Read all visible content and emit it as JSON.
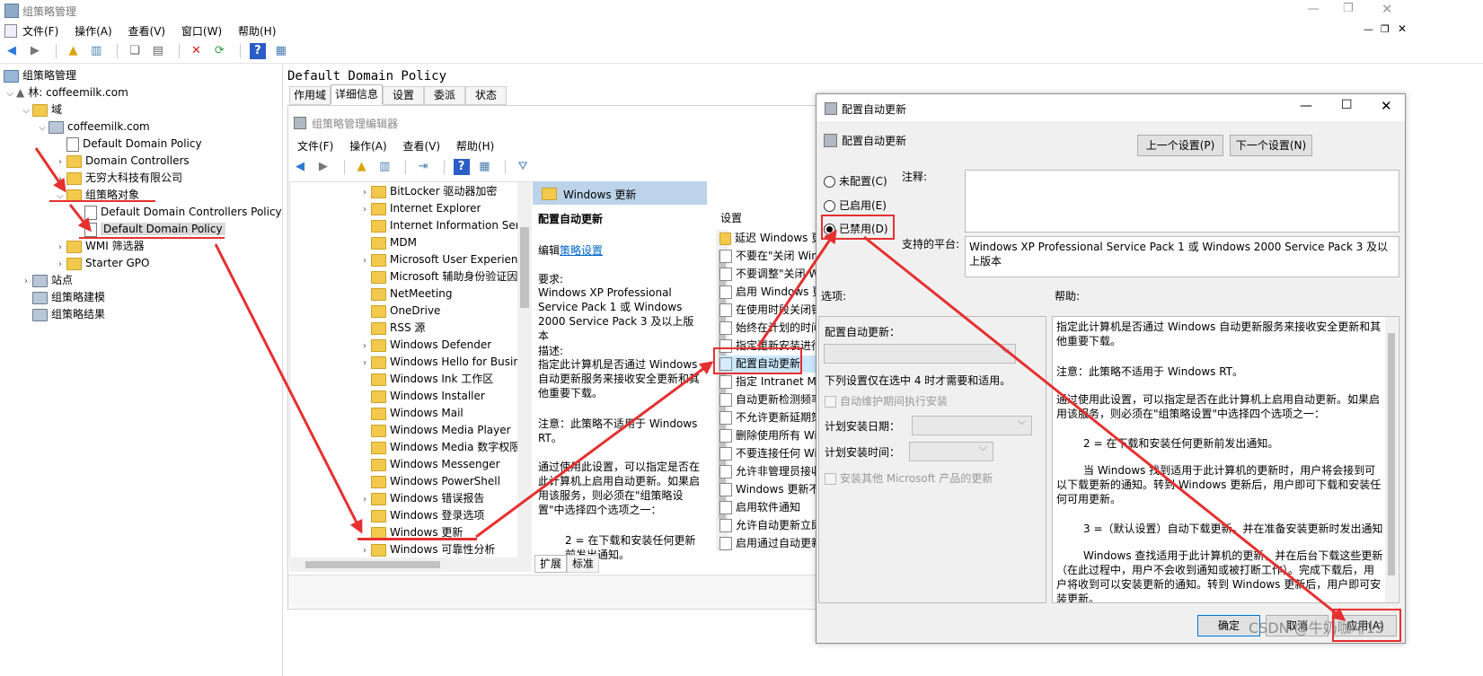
{
  "main_window": {
    "title": "组策略管理",
    "menu": [
      "文件(F)",
      "操作(A)",
      "查看(V)",
      "窗口(W)",
      "帮助(H)"
    ]
  },
  "tree": {
    "root": "组策略管理",
    "forest": "林: coffeemilk.com",
    "domains": "域",
    "domain": "coffeemilk.com",
    "items": [
      "Default Domain Policy",
      "Domain Controllers",
      "无穷大科技有限公司",
      "组策略对象",
      "Default Domain Controllers Policy",
      "Default Domain Policy",
      "WMI 筛选器",
      "Starter GPO"
    ],
    "sites": "站点",
    "modeling": "组策略建模",
    "results": "组策略结果"
  },
  "detail": {
    "title": "Default Domain Policy",
    "tabs": [
      "作用域",
      "详细信息",
      "设置",
      "委派",
      "状态"
    ]
  },
  "editor": {
    "title": "组策略管理编辑器",
    "menu": [
      "文件(F)",
      "操作(A)",
      "查看(V)",
      "帮助(H)"
    ],
    "tree_items": [
      "BitLocker 驱动器加密",
      "Internet Explorer",
      "Internet Information Serv",
      "MDM",
      "Microsoft User Experienc",
      "Microsoft 辅助身份验证因",
      "NetMeeting",
      "OneDrive",
      "RSS 源",
      "Windows Defender",
      "Windows Hello for Busin",
      "Windows Ink 工作区",
      "Windows Installer",
      "Windows Mail",
      "Windows Media Player",
      "Windows Media 数字权限",
      "Windows Messenger",
      "Windows PowerShell",
      "Windows 错误报告",
      "Windows 登录选项",
      "Windows 更新",
      "Windows 可靠性分析"
    ],
    "panel_header": "Windows 更新",
    "selected_title": "配置自动更新",
    "edit_prefix": "编辑",
    "edit_link": "策略设置",
    "requirements_label": "要求:",
    "requirements_text": "Windows XP Professional Service Pack 1 或 Windows 2000 Service Pack 3 及以上版本",
    "description_label": "描述:",
    "description_1": "指定此计算机是否通过 Windows 自动更新服务来接收安全更新和其他重要下载。",
    "description_2": "注意：此策略不适用于 Windows RT。",
    "description_3": "通过使用此设置，可以指定是否在此计算机上启用自动更新。如果启用该服务，则必须在\"组策略设置\"中选择四个选项之一：",
    "description_4": "2 = 在下载和安装任何更新前发出通知。",
    "settings_header": "设置",
    "settings_items": [
      "延迟 Windows 更",
      "不要在\"关闭 Winc",
      "不要调整\"关闭 Wi",
      "启用 Windows 更",
      "在使用时段关闭针",
      "始终在计划的时间",
      "指定更新安装进行",
      "配置自动更新",
      "指定 Intranet Mic",
      "自动更新检测频率",
      "不允许更新延期策",
      "删除使用所有 Wir",
      "不要连接任何 Wir",
      "允许非管理员接收",
      "Windows 更新不仓",
      "启用软件通知",
      "允许自动更新立即",
      "启用通过自动更新"
    ],
    "bottom_tabs": [
      "扩展",
      "标准"
    ]
  },
  "dialog": {
    "title": "配置自动更新",
    "subtitle": "配置自动更新",
    "prev_button": "上一个设置(P)",
    "next_button": "下一个设置(N)",
    "radio_not_configured": "未配置(C)",
    "radio_enabled": "已启用(E)",
    "radio_disabled": "已禁用(D)",
    "comment_label": "注释:",
    "platform_label": "支持的平台:",
    "platform_text": "Windows XP Professional Service Pack 1 或 Windows 2000 Service Pack 3 及以上版本",
    "options_label": "选项:",
    "help_label": "帮助:",
    "opt_configure": "配置自动更新：",
    "opt_note": "下列设置仅在选中 4 时才需要和适用。",
    "opt_maintenance": "自动维护期间执行安装",
    "opt_day_label": "计划安装日期：",
    "opt_time_label": "计划安装时间：",
    "opt_other": "安装其他 Microsoft 产品的更新",
    "help_p1": "指定此计算机是否通过 Windows 自动更新服务来接收安全更新和其他重要下载。",
    "help_p2": "注意：此策略不适用于 Windows RT。",
    "help_p3": "通过使用此设置，可以指定是否在此计算机上启用自动更新。如果启用该服务，则必须在\"组策略设置\"中选择四个选项之一：",
    "help_p4": "2 = 在下载和安装任何更新前发出通知。",
    "help_p5": "当 Windows 找到适用于此计算机的更新时，用户将会接到可以下载更新的通知。转到 Windows 更新后，用户即可下载和安装任何可用更新。",
    "help_p6": "3 =（默认设置）自动下载更新，并在准备安装更新时发出通知",
    "help_p7": "Windows 查找适用于此计算机的更新，并在后台下载这些更新（在此过程中，用户不会收到通知或被打断工作）。完成下载后，用户将收到可以安装更新的通知。转到 Windows 更新后，用户即可安装更新。",
    "ok": "确定",
    "cancel": "取消",
    "apply": "应用(A)"
  },
  "watermark": "CSDN @牛奶咖啡13",
  "colors": {
    "accent": "#e53030",
    "selection": "#cce8ff",
    "link": "#0066cc",
    "header_blue": "#bcd3ea"
  }
}
